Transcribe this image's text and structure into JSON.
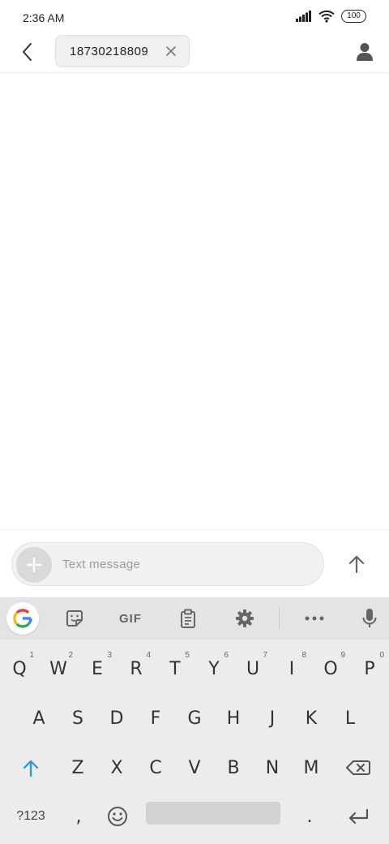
{
  "status_bar": {
    "time": "2:36 AM",
    "battery": "100",
    "icons": [
      "signal-icon",
      "wifi-icon",
      "battery-icon"
    ]
  },
  "header": {
    "back_icon": "back-arrow-icon",
    "recipient": "18730218809",
    "remove_icon": "close-icon",
    "contact_icon": "person-icon"
  },
  "composer": {
    "add_icon": "plus-icon",
    "placeholder": "Text message",
    "value": "",
    "send_icon": "arrow-up-icon"
  },
  "keyboard": {
    "toolbar": {
      "google": "google-icon",
      "sticker": "sticker-icon",
      "gif": "GIF",
      "clipboard": "clipboard-icon",
      "settings": "gear-icon",
      "more": "more-icon",
      "mic": "mic-icon"
    },
    "row1": [
      {
        "label": "Q",
        "hint": "1"
      },
      {
        "label": "W",
        "hint": "2"
      },
      {
        "label": "E",
        "hint": "3"
      },
      {
        "label": "R",
        "hint": "4"
      },
      {
        "label": "T",
        "hint": "5"
      },
      {
        "label": "Y",
        "hint": "6"
      },
      {
        "label": "U",
        "hint": "7"
      },
      {
        "label": "I",
        "hint": "8"
      },
      {
        "label": "O",
        "hint": "9"
      },
      {
        "label": "P",
        "hint": "0"
      }
    ],
    "row2": [
      "A",
      "S",
      "D",
      "F",
      "G",
      "H",
      "J",
      "K",
      "L"
    ],
    "row3": [
      "Z",
      "X",
      "C",
      "V",
      "B",
      "N",
      "M"
    ],
    "row4": {
      "symbols": "?123",
      "comma": ",",
      "period": "."
    },
    "colors": {
      "shift": "#2196f3",
      "key_text": "#333333",
      "background": "#ececec"
    }
  }
}
